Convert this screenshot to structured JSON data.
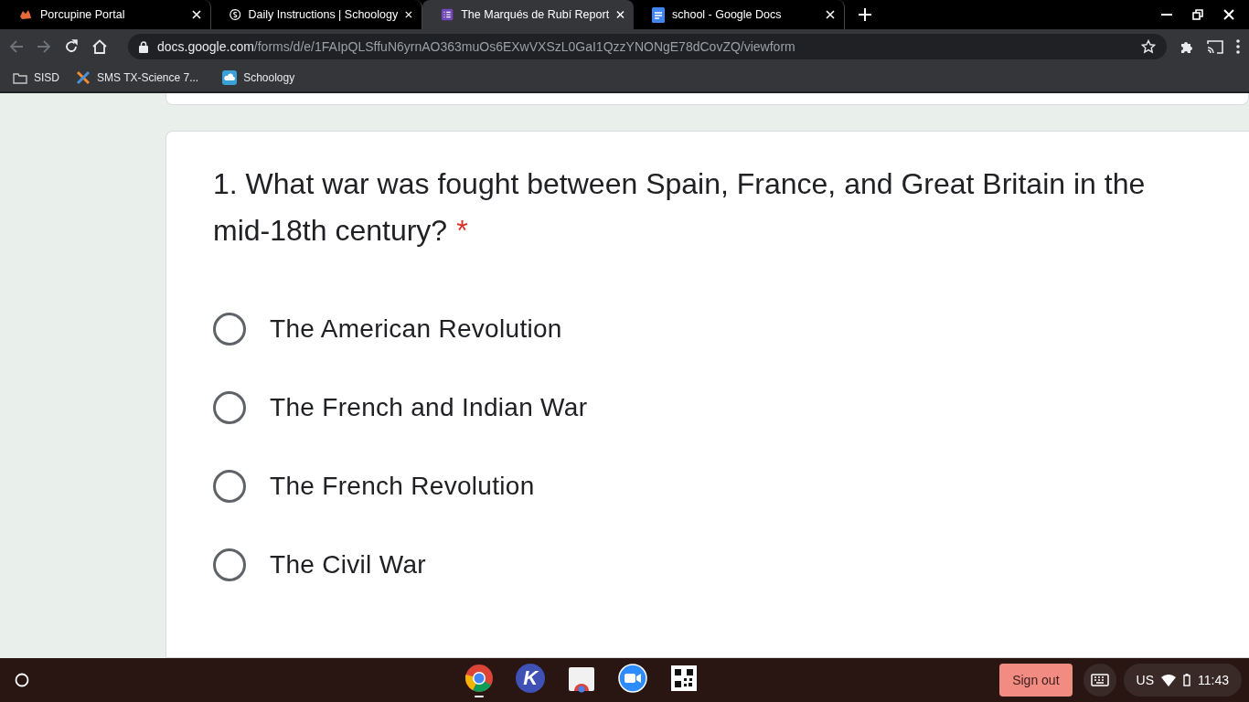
{
  "tabs": [
    {
      "title": "Porcupine Portal",
      "selected": false
    },
    {
      "title": "Daily Instructions | Schoology",
      "selected": false
    },
    {
      "title": "The Marqués de Rubí Report",
      "selected": true
    },
    {
      "title": "school - Google Docs",
      "selected": false
    }
  ],
  "address": {
    "host": "docs.google.com",
    "path": "/forms/d/e/1FAIpQLSffuN6yrnAO363muOs6EXwVXSzL0GaI1QzzYNONgE78dCovZQ/viewform"
  },
  "bookmarks": [
    {
      "label": "SISD"
    },
    {
      "label": "SMS TX-Science 7..."
    },
    {
      "label": "Schoology"
    }
  ],
  "question": {
    "text": "1. What war was fought between Spain, France, and Great Britain in the mid-18th century?",
    "required_mark": "*",
    "options": [
      {
        "label": "The American Revolution",
        "selected": false
      },
      {
        "label": "The French and Indian War",
        "selected": false
      },
      {
        "label": "The French Revolution",
        "selected": false
      },
      {
        "label": "The Civil War",
        "selected": false
      }
    ]
  },
  "shelf": {
    "apps": [
      {
        "kind": "chrome",
        "active": true
      },
      {
        "kind": "letter",
        "letter": "K",
        "active": false
      },
      {
        "kind": "store",
        "active": false
      },
      {
        "kind": "zoom",
        "active": false
      },
      {
        "kind": "qr",
        "active": false
      }
    ],
    "sign_out": "Sign out",
    "locale": "US",
    "time": "11:43"
  }
}
